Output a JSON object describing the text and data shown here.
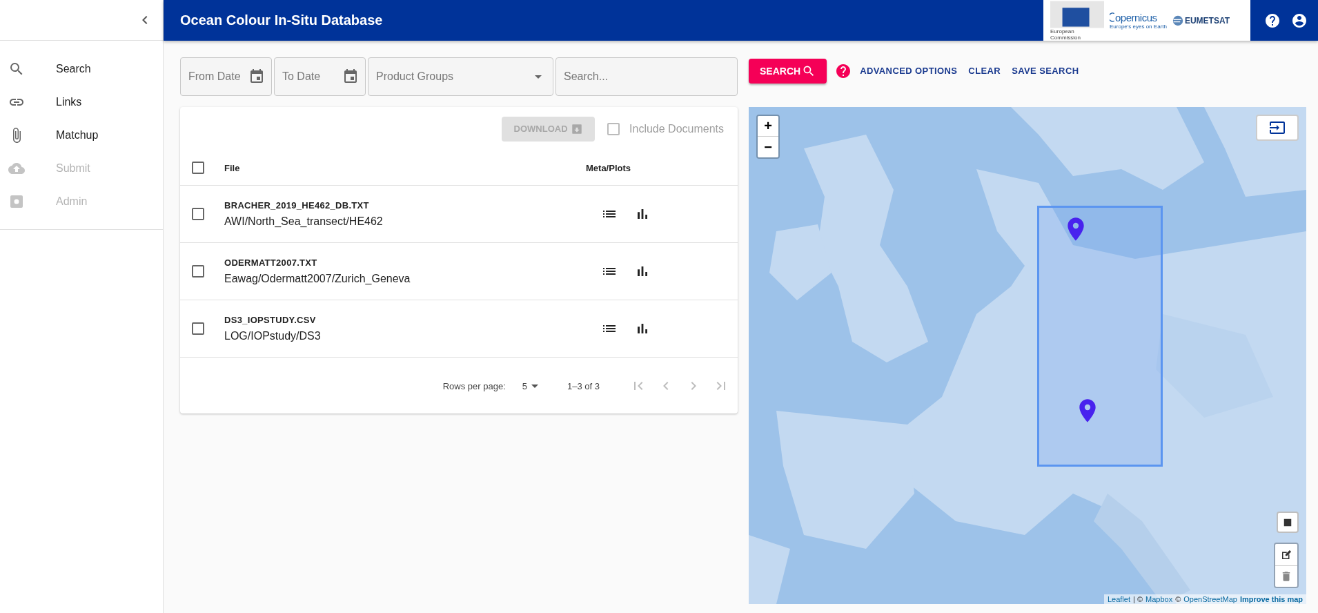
{
  "header": {
    "title": "Ocean Colour In-Situ Database",
    "logos": {
      "commission": "European Commission",
      "copernicus": "opernicus",
      "copernicus_tagline": "Europe's eyes on Earth",
      "eumetsat": "EUMETSAT"
    }
  },
  "sidebar": {
    "items": [
      {
        "label": "Search",
        "disabled": false
      },
      {
        "label": "Links",
        "disabled": false
      },
      {
        "label": "Matchup",
        "disabled": false
      },
      {
        "label": "Submit",
        "disabled": true
      },
      {
        "label": "Admin",
        "disabled": true
      }
    ]
  },
  "filters": {
    "from_date": {
      "placeholder": "From Date"
    },
    "to_date": {
      "placeholder": "To Date"
    },
    "product_groups": {
      "placeholder": "Product Groups"
    },
    "search": {
      "placeholder": "Search..."
    }
  },
  "search_bar": {
    "search_button": "SEARCH",
    "links": [
      "ADVANCED OPTIONS",
      "CLEAR",
      "SAVE SEARCH"
    ]
  },
  "table": {
    "download": {
      "label": "DOWNLOAD",
      "disabled": true
    },
    "include_documents": {
      "label": "Include Documents",
      "checked": false
    },
    "select_all": {
      "checked": false
    },
    "columns": [
      "File",
      "Meta/Plots"
    ],
    "rows": [
      {
        "name": "BRACHER_2019_HE462_DB.TXT",
        "path": "AWI/North_Sea_transect/HE462",
        "checked": false
      },
      {
        "name": "ODERMATT2007.TXT",
        "path": "Eawag/Odermatt2007/Zurich_Geneva",
        "checked": false
      },
      {
        "name": "DS3_IOPSTUDY.CSV",
        "path": "LOG/IOPstudy/DS3",
        "checked": false
      }
    ],
    "pagination": {
      "rows_per_page_label": "Rows per page:",
      "rows_per_page": "5",
      "range": "1–3 of 3",
      "first_disabled": true,
      "previous_disabled": true,
      "next_disabled": true,
      "last_disabled": true
    }
  },
  "map": {
    "zoom_in": "+",
    "zoom_out": "−",
    "attribution": [
      {
        "kind": "link",
        "text": "Leaflet"
      },
      {
        "kind": "text",
        "text": "| ©"
      },
      {
        "kind": "link",
        "text": "Mapbox"
      },
      {
        "kind": "text",
        "text": "©"
      },
      {
        "kind": "link",
        "text": "OpenStreetMap"
      },
      {
        "kind": "strong",
        "text": "Improve this map"
      }
    ]
  }
}
